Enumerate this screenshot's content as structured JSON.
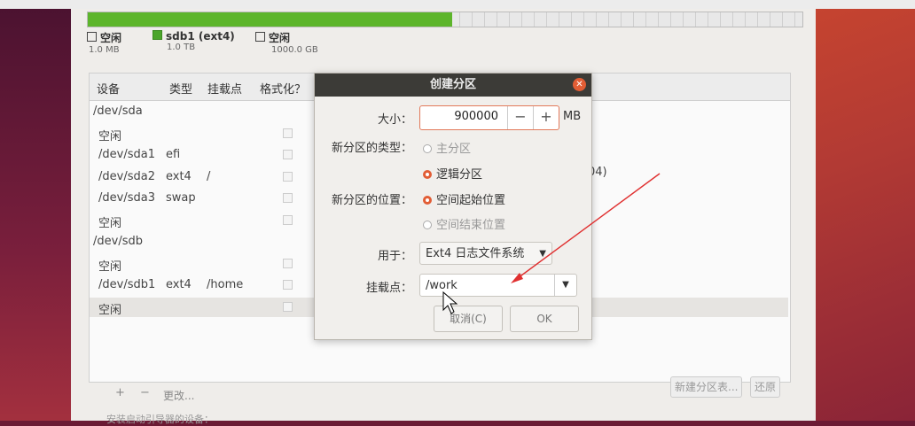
{
  "partition_bar": {
    "used_fraction": 0.51
  },
  "legend": [
    {
      "label": "空闲",
      "size": "1.0 MB"
    },
    {
      "label": "sdb1 (ext4)",
      "size": "1.0 TB"
    },
    {
      "label": "空闲",
      "size": "1000.0 GB"
    }
  ],
  "table": {
    "headers": [
      "设备",
      "类型",
      "挂载点",
      "格式化？"
    ],
    "rows": [
      {
        "device": "/dev/sda",
        "type": "",
        "mount": "",
        "indent": 0
      },
      {
        "device": "空闲",
        "type": "",
        "mount": "",
        "indent": 1
      },
      {
        "device": "/dev/sda1",
        "type": "efi",
        "mount": "",
        "indent": 1
      },
      {
        "device": "/dev/sda2",
        "type": "ext4",
        "mount": "/",
        "indent": 1
      },
      {
        "device": "/dev/sda3",
        "type": "swap",
        "mount": "",
        "indent": 1
      },
      {
        "device": "空闲",
        "type": "",
        "mount": "",
        "indent": 1
      },
      {
        "device": "/dev/sdb",
        "type": "",
        "mount": "",
        "indent": 0
      },
      {
        "device": "空闲",
        "type": "",
        "mount": "",
        "indent": 1
      },
      {
        "device": "/dev/sdb1",
        "type": "ext4",
        "mount": "/home",
        "indent": 1
      },
      {
        "device": "空闲",
        "type": "",
        "mount": "",
        "indent": 1
      }
    ],
    "partial_note": "04)"
  },
  "toolbar": {
    "add": "+",
    "remove": "−",
    "change": "更改..."
  },
  "buttons": {
    "new_table": "新建分区表...",
    "revert": "还原"
  },
  "footer_note": "安装启动引导器的设备：",
  "dialog": {
    "title": "创建分区",
    "size_label": "大小：",
    "size_value": "900000",
    "size_unit": "MB",
    "minus": "−",
    "plus": "+",
    "type_label": "新分区的类型：",
    "type_options": [
      "主分区",
      "逻辑分区"
    ],
    "type_selected": 1,
    "location_label": "新分区的位置：",
    "location_options": [
      "空间起始位置",
      "空间结束位置"
    ],
    "location_selected": 0,
    "use_label": "用于：",
    "use_value": "Ext4 日志文件系统",
    "mount_label": "挂载点：",
    "mount_value": "/work",
    "cancel": "取消(C)",
    "ok": "OK"
  },
  "colors": {
    "accent": "#e25d35",
    "bar_green": "#5db52b"
  }
}
